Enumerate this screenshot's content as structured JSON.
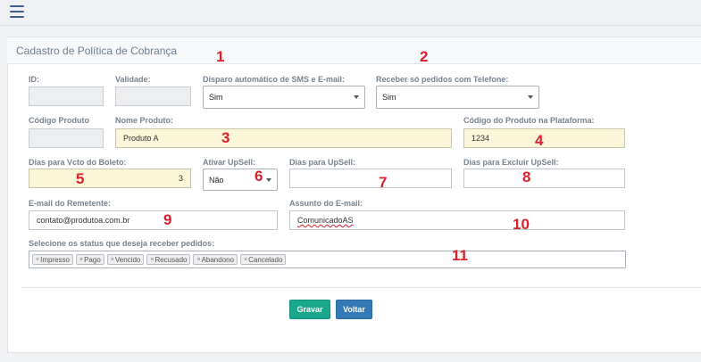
{
  "panel": {
    "title": "Cadastro de Política de Cobrança"
  },
  "fields": {
    "id": {
      "label": "ID:",
      "value": ""
    },
    "validade": {
      "label": "Validade:",
      "value": ""
    },
    "disparo": {
      "label": "Disparo automático de SMS e E-mail:",
      "value": "Sim"
    },
    "receber_telefone": {
      "label": "Receber só pedidos com Telefone:",
      "value": "Sim"
    },
    "codigo_produto": {
      "label": "Código Produto",
      "value": ""
    },
    "nome_produto": {
      "label": "Nome Produto:",
      "value": "Produto A"
    },
    "codigo_plataforma": {
      "label": "Código do Produto na Plataforma:",
      "value": "1234"
    },
    "dias_vcto": {
      "label": "Dias para Vcto do Boleto:",
      "value": "3"
    },
    "ativar_upsell": {
      "label": "Ativar UpSell:",
      "value": "Não"
    },
    "dias_upsell": {
      "label": "Dias para UpSell:",
      "value": ""
    },
    "dias_excluir_upsell": {
      "label": "Dias para Excluir UpSell:",
      "value": ""
    },
    "email_remetente": {
      "label": "E-mail do Remetente:",
      "value": "contato@produtoa.com.br"
    },
    "assunto_email": {
      "label": "Assunto do E-mail:",
      "value": "ComunicadoAS"
    },
    "status_pedidos": {
      "label": "Selecione os status que deseja receber pedidos:",
      "tags": [
        "Impresso",
        "Pago",
        "Vencido",
        "Recusado",
        "Abandono",
        "Cancelado"
      ],
      "remove_glyph": "×"
    }
  },
  "annotations": [
    "1",
    "2",
    "3",
    "4",
    "5",
    "6",
    "7",
    "8",
    "9",
    "10",
    "11"
  ],
  "buttons": {
    "save": "Gravar",
    "back": "Voltar"
  },
  "colors": {
    "annotation": "#d8212d",
    "save": "#19a88b",
    "back": "#337ab7",
    "highlight": "#fbf6d7"
  }
}
